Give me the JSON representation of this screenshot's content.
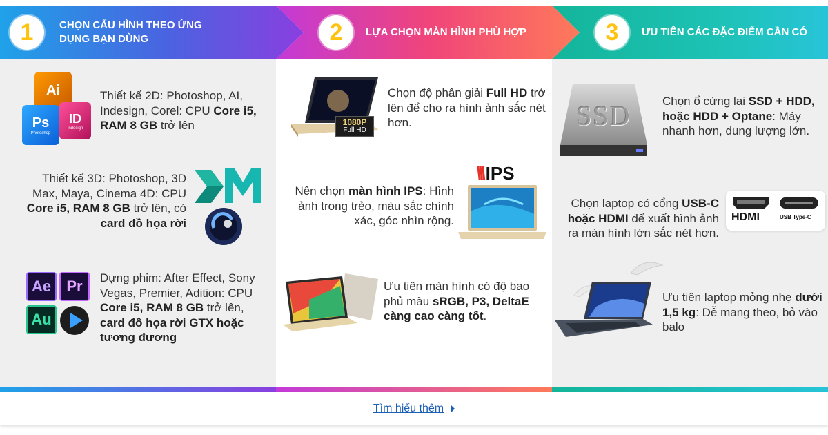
{
  "header": {
    "steps": [
      {
        "number": "1",
        "title": "CHỌN CẤU HÌNH THEO ỨNG DỤNG BẠN DÙNG"
      },
      {
        "number": "2",
        "title": "LỰA CHỌN MÀN HÌNH PHÙ HỢP"
      },
      {
        "number": "3",
        "title": "ƯU TIÊN CÁC ĐẶC ĐIỂM CẦN CÓ"
      }
    ]
  },
  "col1": {
    "item1": {
      "t1": "Thiết kế 2D: Photoshop, AI, Indesign, Corel: CPU ",
      "b1": "Core i5, RAM 8 GB",
      "t2": " trở lên"
    },
    "item2": {
      "t1": "Thiết kế 3D: Photoshop, 3D Max, Maya, Cinema 4D: CPU ",
      "b1": "Core i5, RAM 8 GB",
      "t2": " trở lên, có ",
      "b2": "card đồ họa rời"
    },
    "item3": {
      "t1": "Dựng phim: After Effect, Sony Vegas, Premier, Adition: CPU ",
      "b1": "Core i5, RAM 8 GB",
      "t2": " trở lên, ",
      "b2": "card đồ họa rời GTX hoặc tương đương"
    },
    "icons": {
      "ai": "Ai",
      "ps": "Ps",
      "id": "ID",
      "ai_sub": "Illustrator",
      "ps_sub": "Photoshop",
      "id_sub": "Indesign",
      "graphic": "Graphic",
      "ae": "Ae",
      "pr": "Pr",
      "au": "Au"
    }
  },
  "col2": {
    "item1": {
      "t1": "Chọn độ phân giải ",
      "b1": "Full HD",
      "t2": " trở lên để cho ra hình ảnh sắc nét hơn."
    },
    "item2": {
      "t1": "Nên chọn ",
      "b1": "màn hình IPS",
      "t2": ": Hình ảnh trong trẻo, màu sắc chính xác, góc nhìn rộng."
    },
    "item3": {
      "t1": "Ưu tiên màn hình có độ bao phủ màu ",
      "b1": "sRGB, P3, DeltaE càng cao càng tốt",
      "t2": "."
    },
    "badge_1080": "1080P",
    "badge_fullhd": "Full HD",
    "ips_logo": "IPS"
  },
  "col3": {
    "item1": {
      "t1": "Chọn ổ cứng lai ",
      "b1": "SSD + HDD, hoặc HDD + Optane",
      "t2": ": Máy nhanh hơn, dung lượng lớn."
    },
    "item2": {
      "t1": "Chọn laptop có cổng ",
      "b1": "USB-C hoặc HDMI",
      "t2": " để xuất hình ảnh ra màn hình lớn sắc nét hơn."
    },
    "item3": {
      "t1": "Ưu tiên laptop mỏng nhẹ ",
      "b1": "dưới 1,5 kg",
      "t2": ": Dễ mang theo, bỏ vào balo"
    },
    "ssd_label": "SSD",
    "hdmi_label": "HDMI",
    "usbc_label": "USB Type-C"
  },
  "footer": {
    "link": "Tìm hiểu thêm"
  },
  "colors": {
    "accent_yellow": "#ffc20e",
    "link": "#1a5fb4",
    "band1": "#4a63e0",
    "band2": "#f0447a",
    "band3": "#1ec2b5"
  }
}
